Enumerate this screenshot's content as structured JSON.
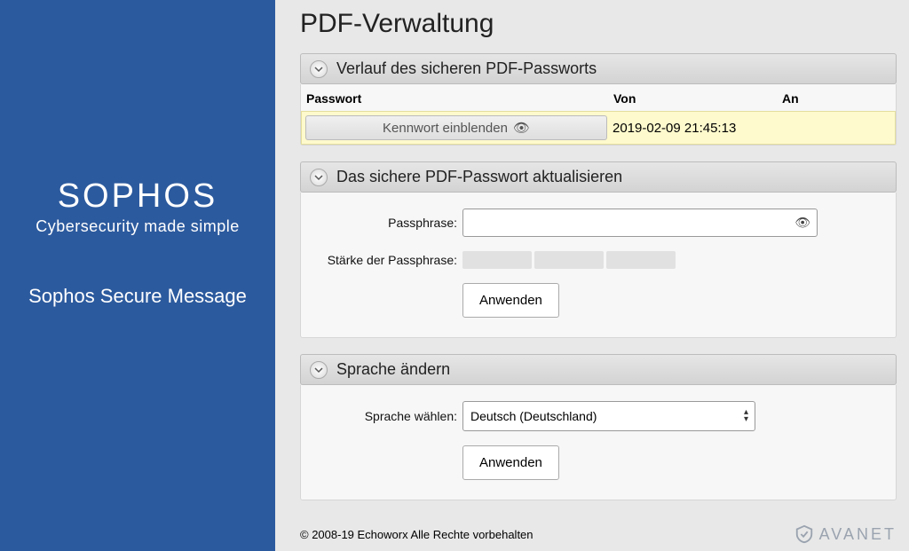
{
  "sidebar": {
    "brand": "SOPHOS",
    "tagline": "Cybersecurity made simple",
    "product": "Sophos Secure Message"
  },
  "page": {
    "title": "PDF-Verwaltung"
  },
  "history": {
    "heading": "Verlauf des sicheren PDF-Passworts",
    "col_password": "Passwort",
    "col_from": "Von",
    "col_to": "An",
    "show_pw_label": "Kennwort einblenden",
    "rows": [
      {
        "from": "2019-02-09 21:45:13",
        "to": ""
      }
    ]
  },
  "update": {
    "heading": "Das sichere PDF-Passwort aktualisieren",
    "passphrase_label": "Passphrase:",
    "strength_label": "Stärke der Passphrase:",
    "apply_label": "Anwenden",
    "passphrase_value": ""
  },
  "lang": {
    "heading": "Sprache ändern",
    "select_label": "Sprache wählen:",
    "selected": "Deutsch (Deutschland)",
    "apply_label": "Anwenden"
  },
  "footer": {
    "copyright": "© 2008-19 Echoworx Alle Rechte vorbehalten",
    "vendor": "AVANET"
  }
}
